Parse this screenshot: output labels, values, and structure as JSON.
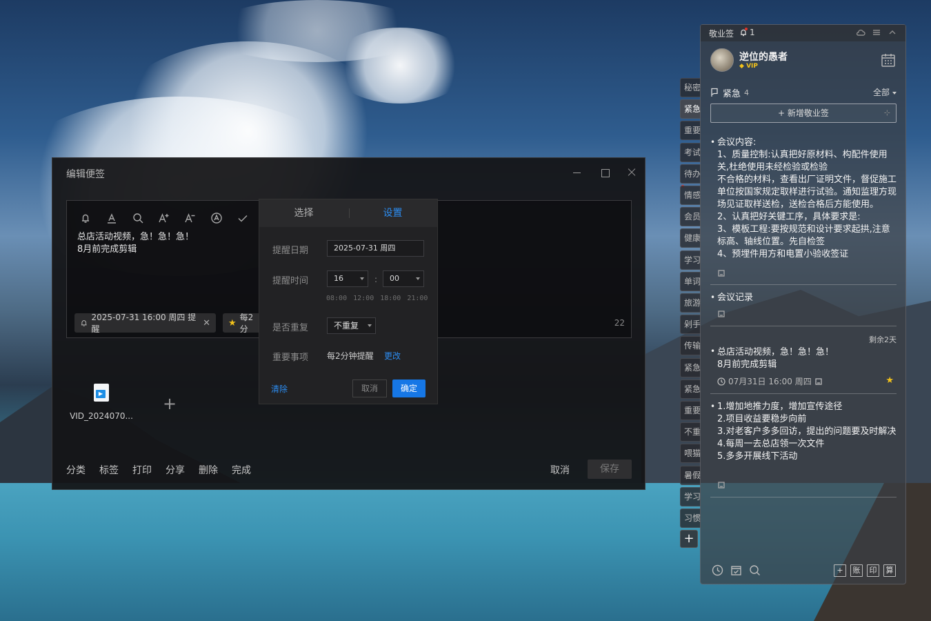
{
  "editor": {
    "title": "编辑便签",
    "note_lines": [
      "总店活动视频，急！急！急！",
      "8月前完成剪辑"
    ],
    "reminder_chip": "2025-07-31 16:00 周四 提醒",
    "priority_chip": "每2分",
    "char_count": "22",
    "attachment_name": "VID_2024070...",
    "bottom_actions": [
      "分类",
      "标签",
      "打印",
      "分享",
      "删除",
      "完成"
    ],
    "cancel_label": "取消",
    "save_label": "保存"
  },
  "popup": {
    "tabs": [
      "选择",
      "设置"
    ],
    "active_tab": "设置",
    "date_label": "提醒日期",
    "date_value": "2025-07-31  周四",
    "time_label": "提醒时间",
    "hour_value": "16",
    "minute_value": "00",
    "colon": ":",
    "quick_times": [
      "08:00",
      "12:00",
      "18:00",
      "21:00"
    ],
    "repeat_label": "是否重复",
    "repeat_value": "不重复",
    "important_label": "重要事项",
    "important_value": "每2分钟提醒",
    "change_label": "更改",
    "clear_label": "清除",
    "cancel_label": "取消",
    "ok_label": "确定"
  },
  "category_tabs": [
    "秘密",
    "紧急",
    "重要",
    "考试",
    "待办",
    "情感",
    "会员",
    "健康",
    "学习",
    "单词",
    "旅游",
    "剁手",
    "传输",
    "紧急",
    "紧急",
    "重要",
    "不重",
    "喂猫",
    "暑假",
    "学习",
    "习惯"
  ],
  "active_category_index": 1,
  "panel": {
    "app_name": "敬业签",
    "notification_count": "1",
    "username": "逆位的愚者",
    "vip_label": "VIP",
    "category_name": "紧急",
    "category_count": "4",
    "filter_label": "全部",
    "new_note_label": "新增敬业签",
    "notes": [
      {
        "lines": [
          "会议内容:",
          "1、质量控制:认真把好原材料、构配件使用关,杜绝使用未经检验或检验",
          "不合格的材料，查看出厂证明文件，督促施工单位按国家规定取样进行试验。通知监理方现场见证取样送检，送检合格后方能使用。",
          "2、认真把好关键工序，具体要求是:",
          "3、模板工程:要按规范和设计要求起拱,注意标高、轴线位置。先自检签",
          "4、预埋件用方和",
          "电置小验收签证"
        ]
      },
      {
        "lines": [
          "会议记录"
        ]
      },
      {
        "remain": "剩余2天",
        "lines": [
          "总店活动视频，急！急！急！",
          "8月前完成剪辑"
        ],
        "reminder": "07月31日 16:00 周四"
      },
      {
        "lines": [
          "1.增加地推力度，增加宣传途径",
          "2.项目收益要稳步向前",
          "3.对老客户多多回访，提出的问题要及时解决",
          "4.每周一去总店领一次文件",
          "5.多多开展线下活动"
        ]
      }
    ],
    "bottom_tools": [
      "账",
      "印",
      "算"
    ]
  }
}
